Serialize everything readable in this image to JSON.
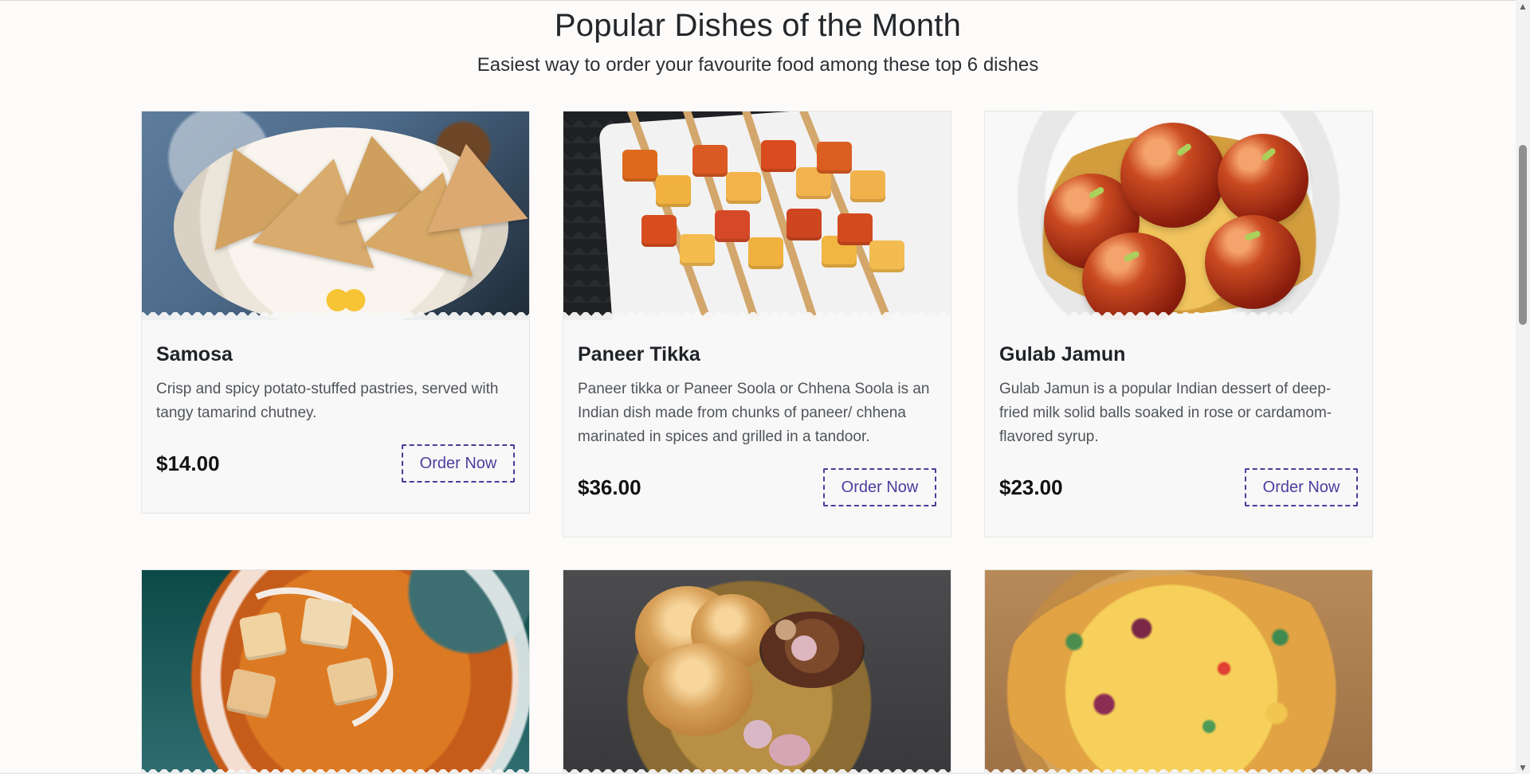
{
  "section": {
    "title": "Popular Dishes of the Month",
    "subtitle": "Easiest way to order your favourite food among these top 6 dishes"
  },
  "cards": [
    {
      "title": "Samosa",
      "description": "Crisp and spicy potato-stuffed pastries, served with tangy tamarind chutney.",
      "price": "$14.00",
      "button": "Order Now"
    },
    {
      "title": "Paneer Tikka",
      "description": "Paneer tikka or Paneer Soola or Chhena Soola is an Indian dish made from chunks of paneer/ chhena marinated in spices and grilled in a tandoor.",
      "price": "$36.00",
      "button": "Order Now"
    },
    {
      "title": "Gulab Jamun",
      "description": "Gulab Jamun is a popular Indian dessert of deep-fried milk solid balls soaked in rose or cardamom-flavored syrup.",
      "price": "$23.00",
      "button": "Order Now"
    }
  ],
  "colors": {
    "accent": "#4b3d9f",
    "background": "#fcfbfa",
    "card": "#f8f8f8"
  }
}
